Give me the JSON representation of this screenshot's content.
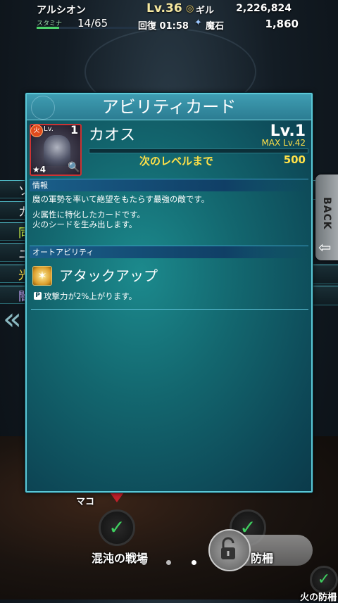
{
  "status": {
    "player_name": "アルシオン",
    "level": "Lv.36",
    "gil_label": "ギル",
    "gil_value": "2,226,824",
    "stamina_label": "スタミナ",
    "stamina_value": "14/65",
    "stamina_fraction": 0.2154,
    "recover": "回復 01:58",
    "stone_label": "魔石",
    "stone_value": "1,860"
  },
  "back_button": "BACK",
  "side_menu_chars": [
    "ソ",
    "カ",
    "同",
    "ニ",
    "光",
    "闇"
  ],
  "dialog": {
    "title": "アビリティカード",
    "card": {
      "lv_label": "Lv.",
      "lv_num": "1",
      "rarity": "★4",
      "name": "カオス",
      "level": "Lv.1",
      "max_level": "MAX Lv.42",
      "next_level_label": "次のレベルまで",
      "next_level_value": "500",
      "exp_fraction": 0.0
    },
    "info": {
      "heading": "情報",
      "line1": "魔の軍勢を率いて絶望をもたらす最強の敵です。",
      "line2": "火属性に特化したカードです。",
      "line3": "火のシードを生み出します。"
    },
    "auto_ability": {
      "heading": "オートアビリティ",
      "name": "アタックアップ",
      "description": "攻撃力が2%上がります。"
    }
  },
  "map": {
    "label_left": "混沌の戦場",
    "label_right": "防柵",
    "label_bottom": "火の防柵",
    "label_partial": "マコ"
  },
  "colors": {
    "dialog_border": "#5ac7d6",
    "accent_yellow": "#ffe048",
    "stamina_green": "#4cd46a",
    "fire_element": "#e04a1c"
  }
}
